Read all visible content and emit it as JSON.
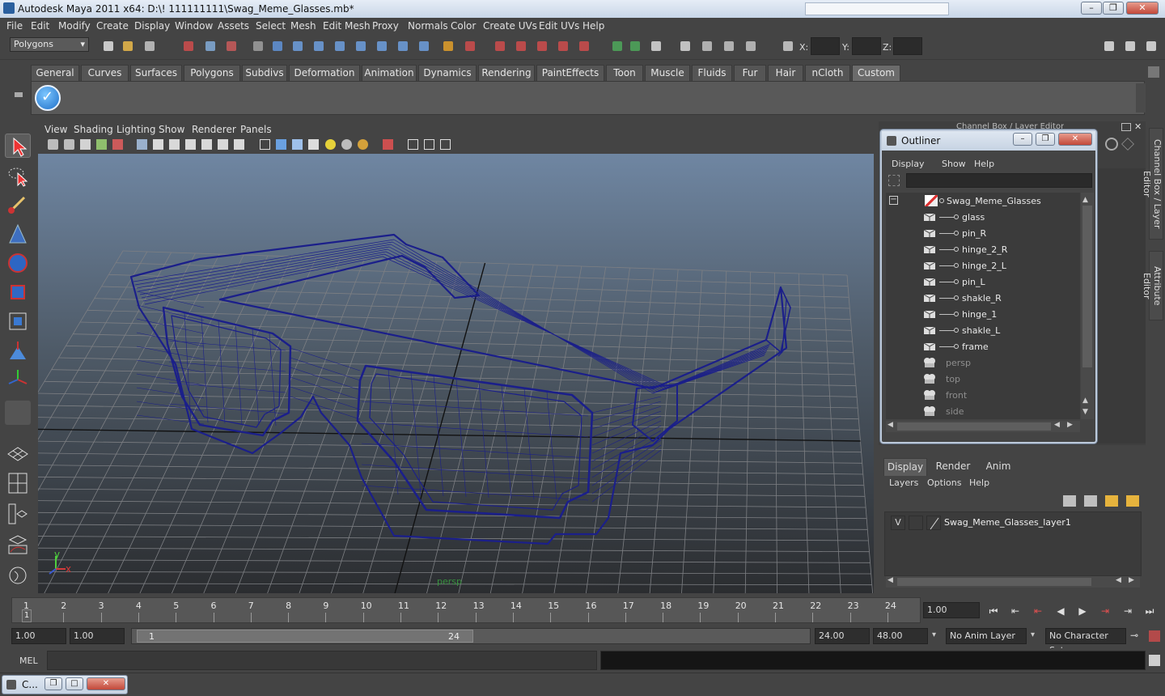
{
  "window": {
    "title": "Autodesk Maya 2011 x64: D:\\! 111111111\\Swag_Meme_Glasses.mb*"
  },
  "menubar": [
    "File",
    "Edit",
    "Modify",
    "Create",
    "Display",
    "Window",
    "Assets",
    "Select",
    "Mesh",
    "Edit Mesh",
    "Proxy",
    "Normals",
    "Color",
    "Create UVs",
    "Edit UVs",
    "Help"
  ],
  "statusline": {
    "mode": "Polygons",
    "x_label": "X:",
    "y_label": "Y:",
    "z_label": "Z:"
  },
  "shelf": {
    "tabs": [
      "General",
      "Curves",
      "Surfaces",
      "Polygons",
      "Subdivs",
      "Deformation",
      "Animation",
      "Dynamics",
      "Rendering",
      "PaintEffects",
      "Toon",
      "Muscle",
      "Fluids",
      "Fur",
      "Hair",
      "nCloth",
      "Custom"
    ],
    "active_tab": "Custom"
  },
  "viewport": {
    "menu": [
      "View",
      "Shading",
      "Lighting",
      "Show",
      "Renderer",
      "Panels"
    ],
    "camera_label": "persp",
    "axis_y": "y",
    "axis_x": "x",
    "wire_color": "#1b1f8a",
    "grid_color": "#7d7f83"
  },
  "channelbox": {
    "title": "Channel Box / Layer Editor"
  },
  "right_tabs": [
    "Channel Box / Layer Editor",
    "Attribute Editor"
  ],
  "outliner": {
    "title": "Outliner",
    "menu": [
      "Display",
      "Show",
      "Help"
    ],
    "root": "Swag_Meme_Glasses",
    "children": [
      "glass",
      "pin_R",
      "hinge_2_R",
      "hinge_2_L",
      "pin_L",
      "shakle_R",
      "hinge_1",
      "shakle_L",
      "frame"
    ],
    "cameras": [
      "persp",
      "top",
      "front",
      "side"
    ]
  },
  "layer_editor": {
    "tabs": [
      "Display",
      "Render",
      "Anim"
    ],
    "active_tab": "Display",
    "menu": [
      "Layers",
      "Options",
      "Help"
    ],
    "layers": [
      {
        "visible": "V",
        "name": "Swag_Meme_Glasses_layer1"
      }
    ]
  },
  "time_slider": {
    "ticks": [
      "1",
      "2",
      "3",
      "4",
      "5",
      "6",
      "7",
      "8",
      "9",
      "10",
      "11",
      "12",
      "13",
      "14",
      "15",
      "16",
      "17",
      "18",
      "19",
      "20",
      "21",
      "22",
      "23",
      "24"
    ],
    "current_frame": "1",
    "current_time": "1.00"
  },
  "range_slider": {
    "start": "1.00",
    "playback_start": "1.00",
    "range_start_label": "1",
    "range_end_label": "24",
    "playback_end": "24.00",
    "end": "48.00",
    "anim_layer": "No Anim Layer",
    "character_set": "No Character Set"
  },
  "command_line": {
    "label": "MEL"
  },
  "minimized_window": {
    "label": "C..."
  }
}
